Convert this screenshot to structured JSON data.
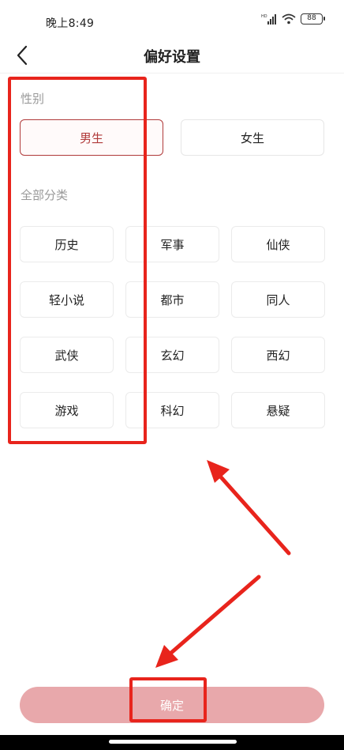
{
  "status_bar": {
    "time": "晚上8:49",
    "battery": "88",
    "icons": [
      "hd-signal-icon",
      "wifi-icon",
      "battery-icon"
    ]
  },
  "header": {
    "title": "偏好设置",
    "back_icon": "chevron-left-icon"
  },
  "gender": {
    "label": "性别",
    "options": [
      {
        "label": "男生",
        "selected": true
      },
      {
        "label": "女生",
        "selected": false
      }
    ]
  },
  "categories": {
    "label": "全部分类",
    "items": [
      "历史",
      "军事",
      "仙侠",
      "轻小说",
      "都市",
      "同人",
      "武侠",
      "玄幻",
      "西幻",
      "游戏",
      "科幻",
      "悬疑"
    ]
  },
  "footer": {
    "confirm_label": "确定"
  },
  "colors": {
    "accent": "#b03a3a",
    "confirm_bg": "#e8a8ab",
    "annotation": "#e8241c"
  }
}
